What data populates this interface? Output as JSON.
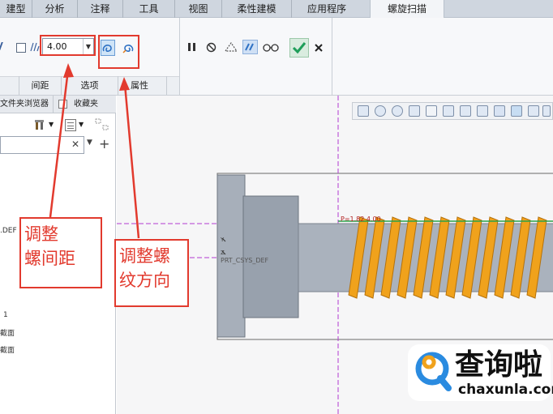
{
  "menu": {
    "tabs": [
      "建型",
      "分析",
      "注释",
      "工具",
      "视图",
      "柔性建模",
      "应用程序",
      "螺旋扫描"
    ]
  },
  "ribbon": {
    "pitch_value": "4.00",
    "groups": [
      "间距",
      "选项",
      "属性"
    ]
  },
  "side_panel": {
    "tabs": [
      "文件夹浏览器",
      "收藏夹"
    ],
    "tree_items": [
      ".DEF",
      "1",
      "截面",
      "截面"
    ]
  },
  "model": {
    "csys_label": "PRT_CSYS_DEF",
    "dim_label": "P=1.82 4.00",
    "y_axis": "Y",
    "z_axis": "Z"
  },
  "annotations": {
    "pitch_note": "调整\n螺间距",
    "direction_note": "调整螺\n纹方向"
  },
  "watermark": {
    "name": "查询啦",
    "url": "chaxunla.com"
  },
  "colors": {
    "accent_red": "#e23a2e",
    "thread_orange": "#f0a21c",
    "shaft_gray": "#a5adb8",
    "confirm_green": "#1f9e5a"
  }
}
